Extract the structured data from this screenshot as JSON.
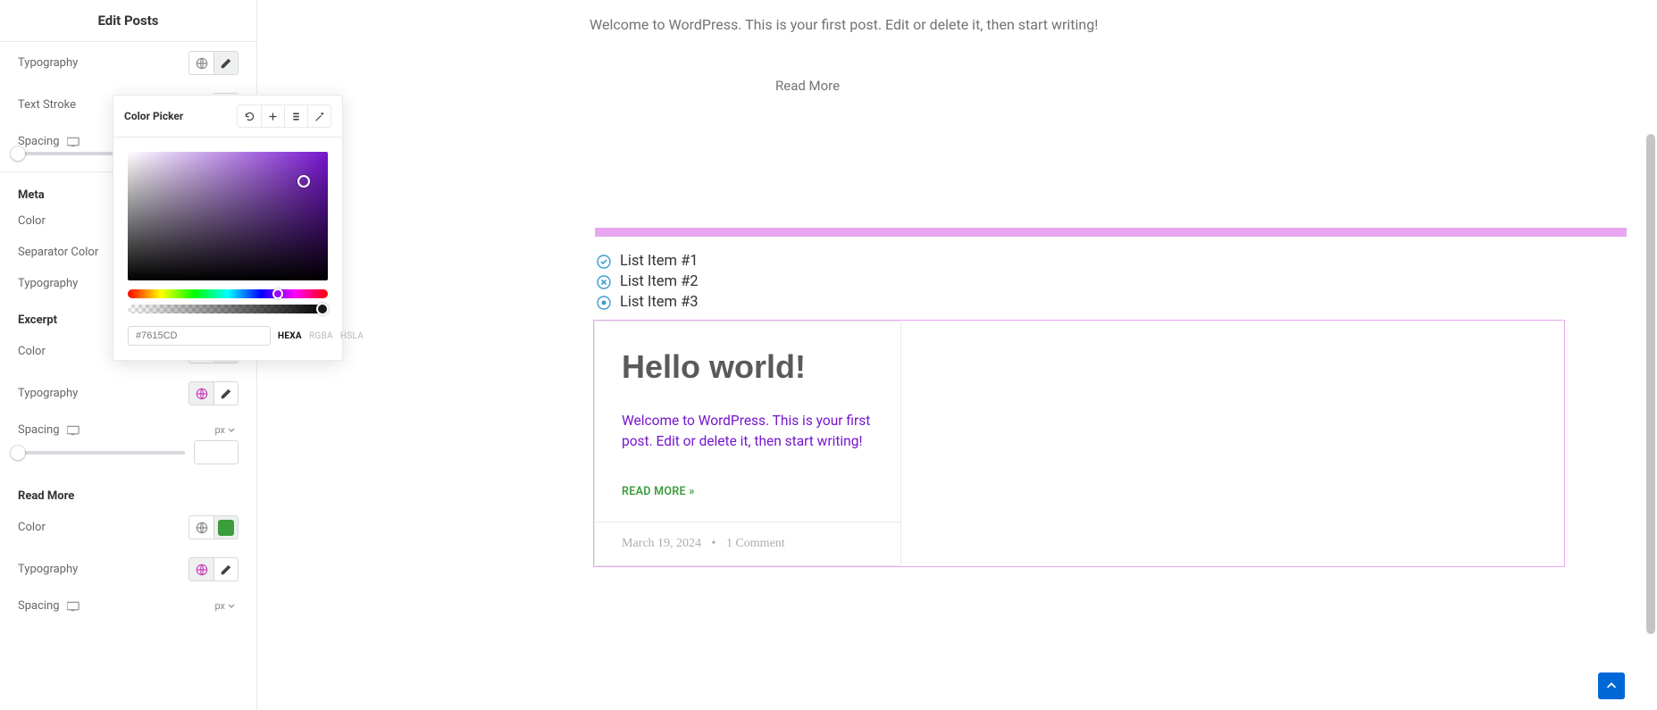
{
  "sidebar": {
    "title": "Edit Posts",
    "groups": {
      "top": {
        "typography": "Typography",
        "text_stroke": "Text Stroke",
        "spacing": "Spacing"
      },
      "meta": {
        "heading": "Meta",
        "color": "Color",
        "separator_color": "Separator Color",
        "typography": "Typography"
      },
      "excerpt": {
        "heading": "Excerpt",
        "color": "Color",
        "typography": "Typography",
        "spacing": "Spacing",
        "spacing_unit": "px"
      },
      "read_more": {
        "heading": "Read More",
        "color": "Color",
        "typography": "Typography",
        "spacing": "Spacing",
        "spacing_unit": "px"
      }
    }
  },
  "colors": {
    "excerpt_swatch": "#7615cd",
    "readmore_swatch": "#3c9d3c",
    "picker_hex": "#7615CD"
  },
  "picker": {
    "title": "Color Picker",
    "formats": {
      "hexa": "HEXA",
      "rgba": "RGBA",
      "hsla": "HSLA"
    }
  },
  "preview": {
    "top_excerpt": "Welcome to WordPress. This is your first post. Edit or delete it, then start writing!",
    "top_readmore": "Read More",
    "list": [
      "List Item #1",
      "List Item #2",
      "List Item #3"
    ],
    "post": {
      "title": "Hello world!",
      "excerpt": "Welcome to WordPress. This is your first post. Edit or delete it, then start writing!",
      "read_more": "READ MORE »",
      "date": "March 19, 2024",
      "comments": "1 Comment"
    }
  }
}
